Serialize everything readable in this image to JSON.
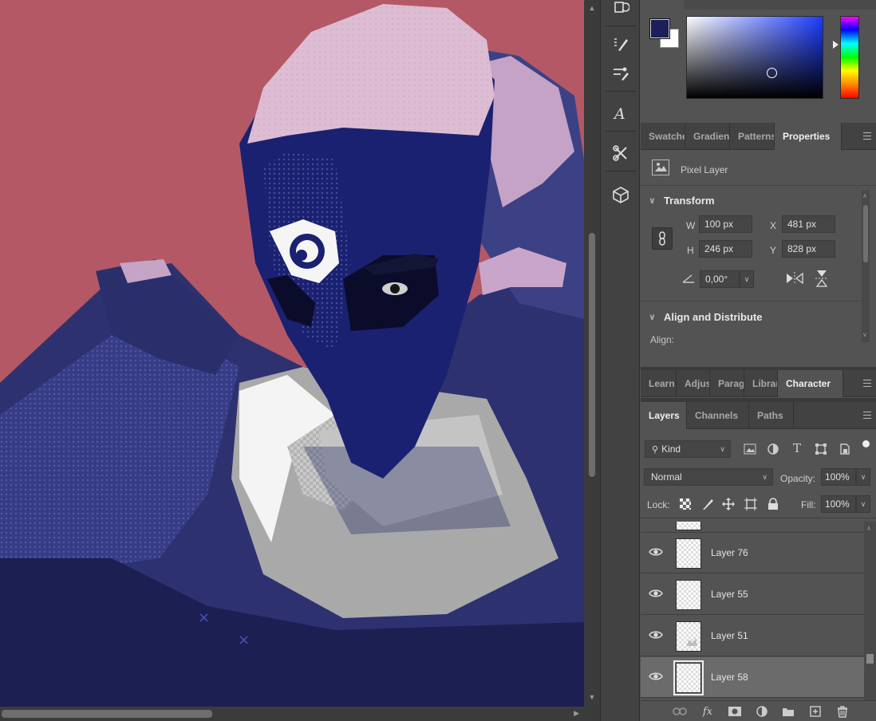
{
  "color_picker": {
    "foreground": "#1b1f5a",
    "background": "#ffffff"
  },
  "tabs_top": [
    {
      "label": "Swatches",
      "active": false
    },
    {
      "label": "Gradients",
      "active": false
    },
    {
      "label": "Patterns",
      "active": false
    },
    {
      "label": "Properties",
      "active": true
    }
  ],
  "properties": {
    "layer_type": "Pixel Layer",
    "transform_title": "Transform",
    "w_label": "W",
    "w_value": "100 px",
    "h_label": "H",
    "h_value": "246 px",
    "x_label": "X",
    "x_value": "481 px",
    "y_label": "Y",
    "y_value": "828 px",
    "angle_value": "0,00°",
    "align_title": "Align and Distribute",
    "align_label": "Align:"
  },
  "tabs_mid": [
    {
      "label": "Learn",
      "active": false
    },
    {
      "label": "Adjustments",
      "active": false
    },
    {
      "label": "Paragraph",
      "active": false
    },
    {
      "label": "Libraries",
      "active": false
    },
    {
      "label": "Character",
      "active": true
    }
  ],
  "tabs_layers": [
    {
      "label": "Layers",
      "active": true
    },
    {
      "label": "Channels",
      "active": false
    },
    {
      "label": "Paths",
      "active": false
    }
  ],
  "layers_panel": {
    "filter_kind": "Kind",
    "blend_mode": "Normal",
    "opacity_label": "Opacity:",
    "opacity_value": "100%",
    "lock_label": "Lock:",
    "fill_label": "Fill:",
    "fill_value": "100%",
    "layers": [
      {
        "name": "Layer 76",
        "visible": true,
        "selected": false
      },
      {
        "name": "Layer 55",
        "visible": true,
        "selected": false
      },
      {
        "name": "Layer 51",
        "visible": true,
        "selected": false
      },
      {
        "name": "Layer 58",
        "visible": true,
        "selected": true
      }
    ]
  }
}
